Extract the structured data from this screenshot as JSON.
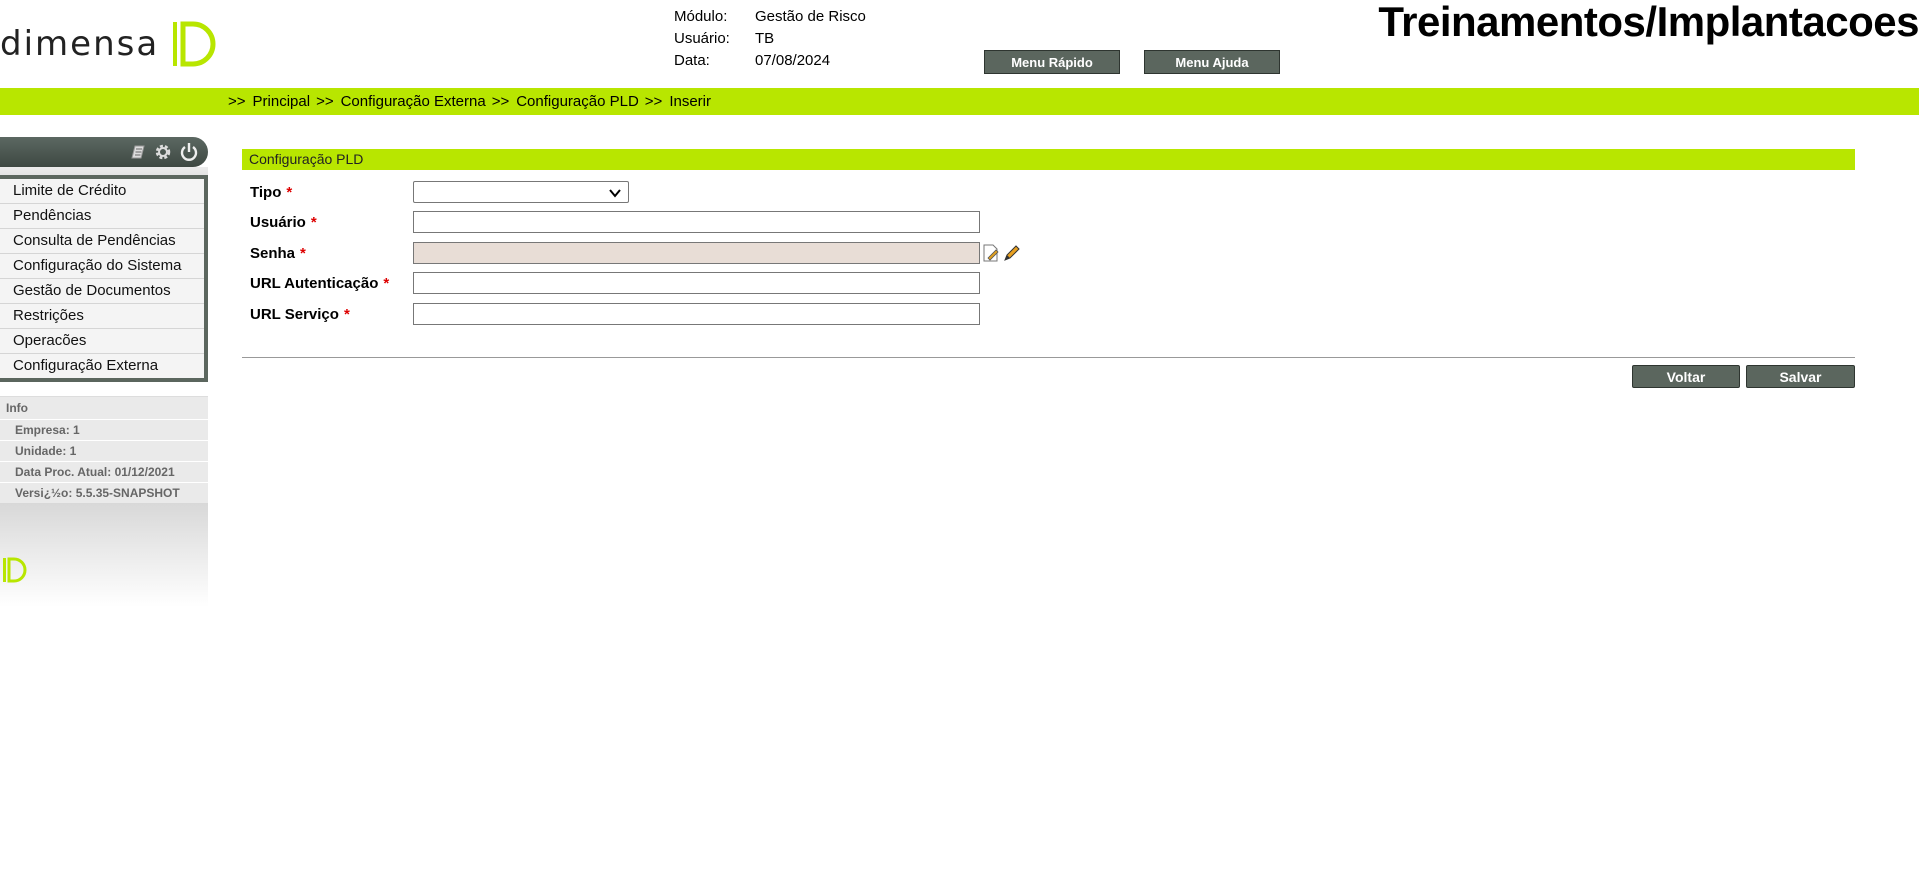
{
  "header": {
    "logo_text": "DIMENSA",
    "info": [
      {
        "key": "Módulo:",
        "value": "Gestão de Risco"
      },
      {
        "key": "Usuário:",
        "value": "TB"
      },
      {
        "key": "Data:",
        "value": "07/08/2024"
      }
    ],
    "menu_rapido": "Menu Rápido",
    "menu_ajuda": "Menu Ajuda",
    "environment_title": "Treinamentos/Implantacoes"
  },
  "breadcrumb": {
    "separator": ">>",
    "items": [
      "Principal",
      "Configuração Externa",
      "Configuração PLD",
      "Inserir"
    ]
  },
  "sidebar": {
    "toolbar_icons": [
      "notepad-icon",
      "gear-icon",
      "power-icon"
    ],
    "menu": [
      "Limite de Crédito",
      "Pendências",
      "Consulta de Pendências",
      "Configuração do Sistema",
      "Gestão de Documentos",
      "Restrições",
      "Operacões",
      "Configuração Externa"
    ],
    "info_title": "Info",
    "info_items": [
      "Empresa: 1",
      "Unidade: 1",
      "Data Proc. Atual: 01/12/2021",
      "Versi¿½o: 5.5.35-SNAPSHOT"
    ]
  },
  "form": {
    "section_title": "Configuração PLD",
    "required_marker": "*",
    "tipo": {
      "label": "Tipo",
      "value": ""
    },
    "usuario": {
      "label": "Usuário",
      "value": ""
    },
    "senha": {
      "label": "Senha",
      "value": ""
    },
    "url_autenticacao": {
      "label": "URL Autenticação",
      "value": ""
    },
    "url_servico": {
      "label": "URL Serviço",
      "value": ""
    },
    "voltar": "Voltar",
    "salvar": "Salvar"
  },
  "colors": {
    "accent_green": "#b8e600",
    "button_dark": "#5b665e",
    "logo_green": "#b8e600"
  }
}
